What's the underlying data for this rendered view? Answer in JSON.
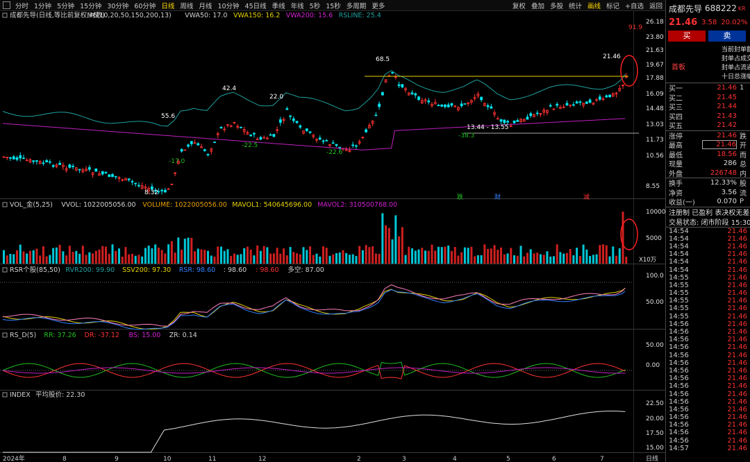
{
  "toolbar": {
    "periods": [
      "分时",
      "1分钟",
      "5分钟",
      "15分钟",
      "30分钟",
      "60分钟",
      "日线",
      "周线",
      "月线",
      "10分钟",
      "45日线",
      "季线",
      "年线",
      "5秒",
      "15秒",
      "多周期",
      "更多"
    ],
    "active_period": "日线",
    "tools": [
      "复权",
      "叠加",
      "多股",
      "统计",
      "画线",
      "标记",
      "+自选",
      "返回"
    ],
    "active_tool": "画线"
  },
  "main_chart": {
    "title": "成都先导(日线,等比前复权,对数)",
    "indicators": [
      {
        "label": "M6(10,20,50,150,200,13)",
        "color": "#d0d0d0"
      },
      {
        "label": "VWA50: 17.0",
        "color": "#d0d0d0"
      },
      {
        "label": "VWA150: 16.2",
        "color": "#e6d200"
      },
      {
        "label": "VWA200: 15.6",
        "color": "#d020d0"
      },
      {
        "label": "RSLINE: 25.4",
        "color": "#20a0a0"
      }
    ],
    "price_axis": [
      "26.18",
      "23.80",
      "21.63",
      "19.67",
      "17.88",
      "16.09",
      "14.48",
      "13.03",
      "11.73",
      "10.56",
      "8.55"
    ],
    "annotations": [
      "68.5",
      "42.4",
      "55.6",
      "22.0",
      "-17.0",
      "-22.5",
      "-22.6",
      "8.32",
      "13.44 - 13.55",
      "-38.3",
      "21.46",
      "91.9"
    ],
    "event_tags": [
      "跌",
      "财",
      "减"
    ]
  },
  "volume_chart": {
    "title": "VOL_金(5,25)",
    "values": [
      {
        "label": "VVOL: 1022005056.00",
        "color": "#d0d0d0"
      },
      {
        "label": "VOLUME: 1022005056.00",
        "color": "#e6a000"
      },
      {
        "label": "MAVOL1: 540645696.00",
        "color": "#e6d200"
      },
      {
        "label": "MAVOL2: 310500768.00",
        "color": "#d020d0"
      }
    ],
    "axis": [
      "10000",
      "5000"
    ],
    "unit": "X10万"
  },
  "rsr_chart": {
    "title": "RSR个股(85,50)",
    "values": [
      {
        "label": "RVR200: 99.90",
        "color": "#20a0a0"
      },
      {
        "label": "SSV200: 97.30",
        "color": "#e6d200"
      },
      {
        "label": "RSR: 98.60",
        "color": "#3080ff"
      },
      {
        "label": ": 98.60",
        "color": "#d0d0d0"
      },
      {
        "label": ": 98.60",
        "color": "#ff3232"
      },
      {
        "label": "多空: 87.00",
        "color": "#d0d0d0"
      }
    ],
    "axis": [
      "100.0",
      "50.00"
    ]
  },
  "rsd_chart": {
    "title": "RS_D(5)",
    "values": [
      {
        "label": "RR: 37.26",
        "color": "#20c020"
      },
      {
        "label": "DR: -37.12",
        "color": "#ff3232"
      },
      {
        "label": "BS: 15.00",
        "color": "#d020d0"
      },
      {
        "label": "ZR: 0.14",
        "color": "#d0d0d0"
      }
    ],
    "axis": [
      "50.00",
      "0.00"
    ]
  },
  "index_chart": {
    "title": "INDEX",
    "values": [
      {
        "label": "平均股价: 22.30",
        "color": "#d0d0d0"
      }
    ],
    "axis": [
      "22.50",
      "20.00",
      "17.50",
      "15.00"
    ]
  },
  "date_axis": {
    "labels": [
      "2024年",
      "8",
      "9",
      "10",
      "11",
      "12",
      "2",
      "3",
      "4",
      "5",
      "6",
      "7"
    ],
    "period_label": "日线"
  },
  "quote_panel": {
    "name": "成都先导",
    "code": "688222",
    "badge": "KR",
    "price": "21.46",
    "change": "3.58",
    "change_pct": "20.02%",
    "buy_label": "买",
    "sell_label": "卖",
    "seal_tag": "首板",
    "seal_lines": [
      "当前封单额",
      "封单占成交",
      "封单占流通",
      "十日总涨幅"
    ],
    "bids": [
      {
        "k": "买一",
        "v": "21.46",
        "x": "1"
      },
      {
        "k": "买二",
        "v": "21.45",
        "x": ""
      },
      {
        "k": "买三",
        "v": "21.44",
        "x": ""
      },
      {
        "k": "买四",
        "v": "21.43",
        "x": ""
      },
      {
        "k": "买五",
        "v": "21.42",
        "x": ""
      }
    ],
    "stats1": [
      {
        "k": "涨停",
        "v": "21.46",
        "x": "跌",
        "white": false,
        "boxed": false
      },
      {
        "k": "最高",
        "v": "21.46",
        "x": "开",
        "white": false,
        "boxed": true
      },
      {
        "k": "最低",
        "v": "18.56",
        "x": "而",
        "white": false,
        "boxed": false
      },
      {
        "k": "现量",
        "v": "286",
        "x": "总",
        "white": true,
        "boxed": false
      },
      {
        "k": "外盘",
        "v": "226748",
        "x": "内",
        "white": false,
        "boxed": false
      }
    ],
    "stats2": [
      {
        "k": "换手",
        "v": "12.33%",
        "x": "股",
        "white": true
      },
      {
        "k": "净资",
        "v": "3.56",
        "x": "流",
        "white": true
      },
      {
        "k": "收益(一)",
        "v": "0.070",
        "x": "P",
        "white": true
      }
    ],
    "info_lines": [
      "注册制 已盈利 表决权无差异",
      "交易状态: 闭市阶段 15:30:"
    ],
    "ticks": [
      {
        "t": "14:54",
        "v": "21.46"
      },
      {
        "t": "14:54",
        "v": "21.46"
      },
      {
        "t": "14:54",
        "v": "21.46"
      },
      {
        "t": "14:54",
        "v": "21.46"
      },
      {
        "t": "14:54",
        "v": "21.46"
      },
      {
        "t": "14:54",
        "v": "21.46"
      },
      {
        "t": "14:55",
        "v": "21.46"
      },
      {
        "t": "14:55",
        "v": "21.46"
      },
      {
        "t": "14:55",
        "v": "21.46"
      },
      {
        "t": "14:55",
        "v": "21.46"
      },
      {
        "t": "14:55",
        "v": "21.46"
      },
      {
        "t": "14:55",
        "v": "21.46"
      },
      {
        "t": "14:56",
        "v": "21.46"
      },
      {
        "t": "14:56",
        "v": "21.46"
      },
      {
        "t": "14:56",
        "v": "21.46"
      },
      {
        "t": "14:56",
        "v": "21.46"
      },
      {
        "t": "14:56",
        "v": "21.46"
      },
      {
        "t": "14:56",
        "v": "21.46"
      },
      {
        "t": "14:56",
        "v": "21.46"
      },
      {
        "t": "14:56",
        "v": "21.46"
      },
      {
        "t": "14:56",
        "v": "21.46"
      },
      {
        "t": "14:56",
        "v": "21.46"
      },
      {
        "t": "14:56",
        "v": "21.46"
      },
      {
        "t": "14:56",
        "v": "21.46"
      },
      {
        "t": "14:56",
        "v": "21.46"
      },
      {
        "t": "14:56",
        "v": "21.46"
      },
      {
        "t": "14:56",
        "v": "21.46"
      },
      {
        "t": "14:56",
        "v": "21.46"
      },
      {
        "t": "14:57",
        "v": "21.46"
      }
    ]
  },
  "colors": {
    "up": "#ff3232",
    "down": "#00ffff",
    "accent": "#ffd800",
    "background": "#000000"
  }
}
